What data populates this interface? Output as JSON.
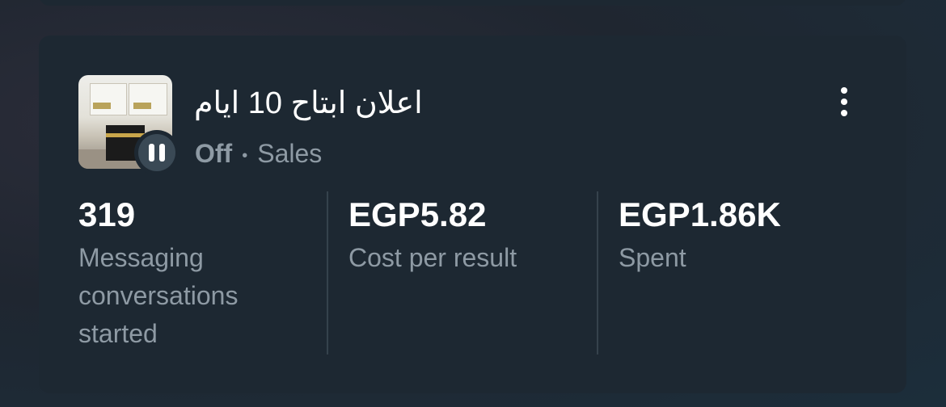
{
  "ad_card": {
    "title": "اعلان ابتاح 10 ايام",
    "status": "Off",
    "separator": "•",
    "objective": "Sales",
    "thumbnail_icon": "kaaba-image",
    "status_icon": "pause-icon",
    "more_icon": "more-vertical-icon",
    "metrics": [
      {
        "value": "319",
        "label": "Messaging conversations started"
      },
      {
        "value": "EGP5.82",
        "label": "Cost per result"
      },
      {
        "value": "EGP1.86K",
        "label": "Spent"
      }
    ]
  },
  "colors": {
    "card_bg": "#1d2832",
    "primary_text": "#ffffff",
    "secondary_text": "#8e9aa4",
    "divider": "#35424c"
  }
}
